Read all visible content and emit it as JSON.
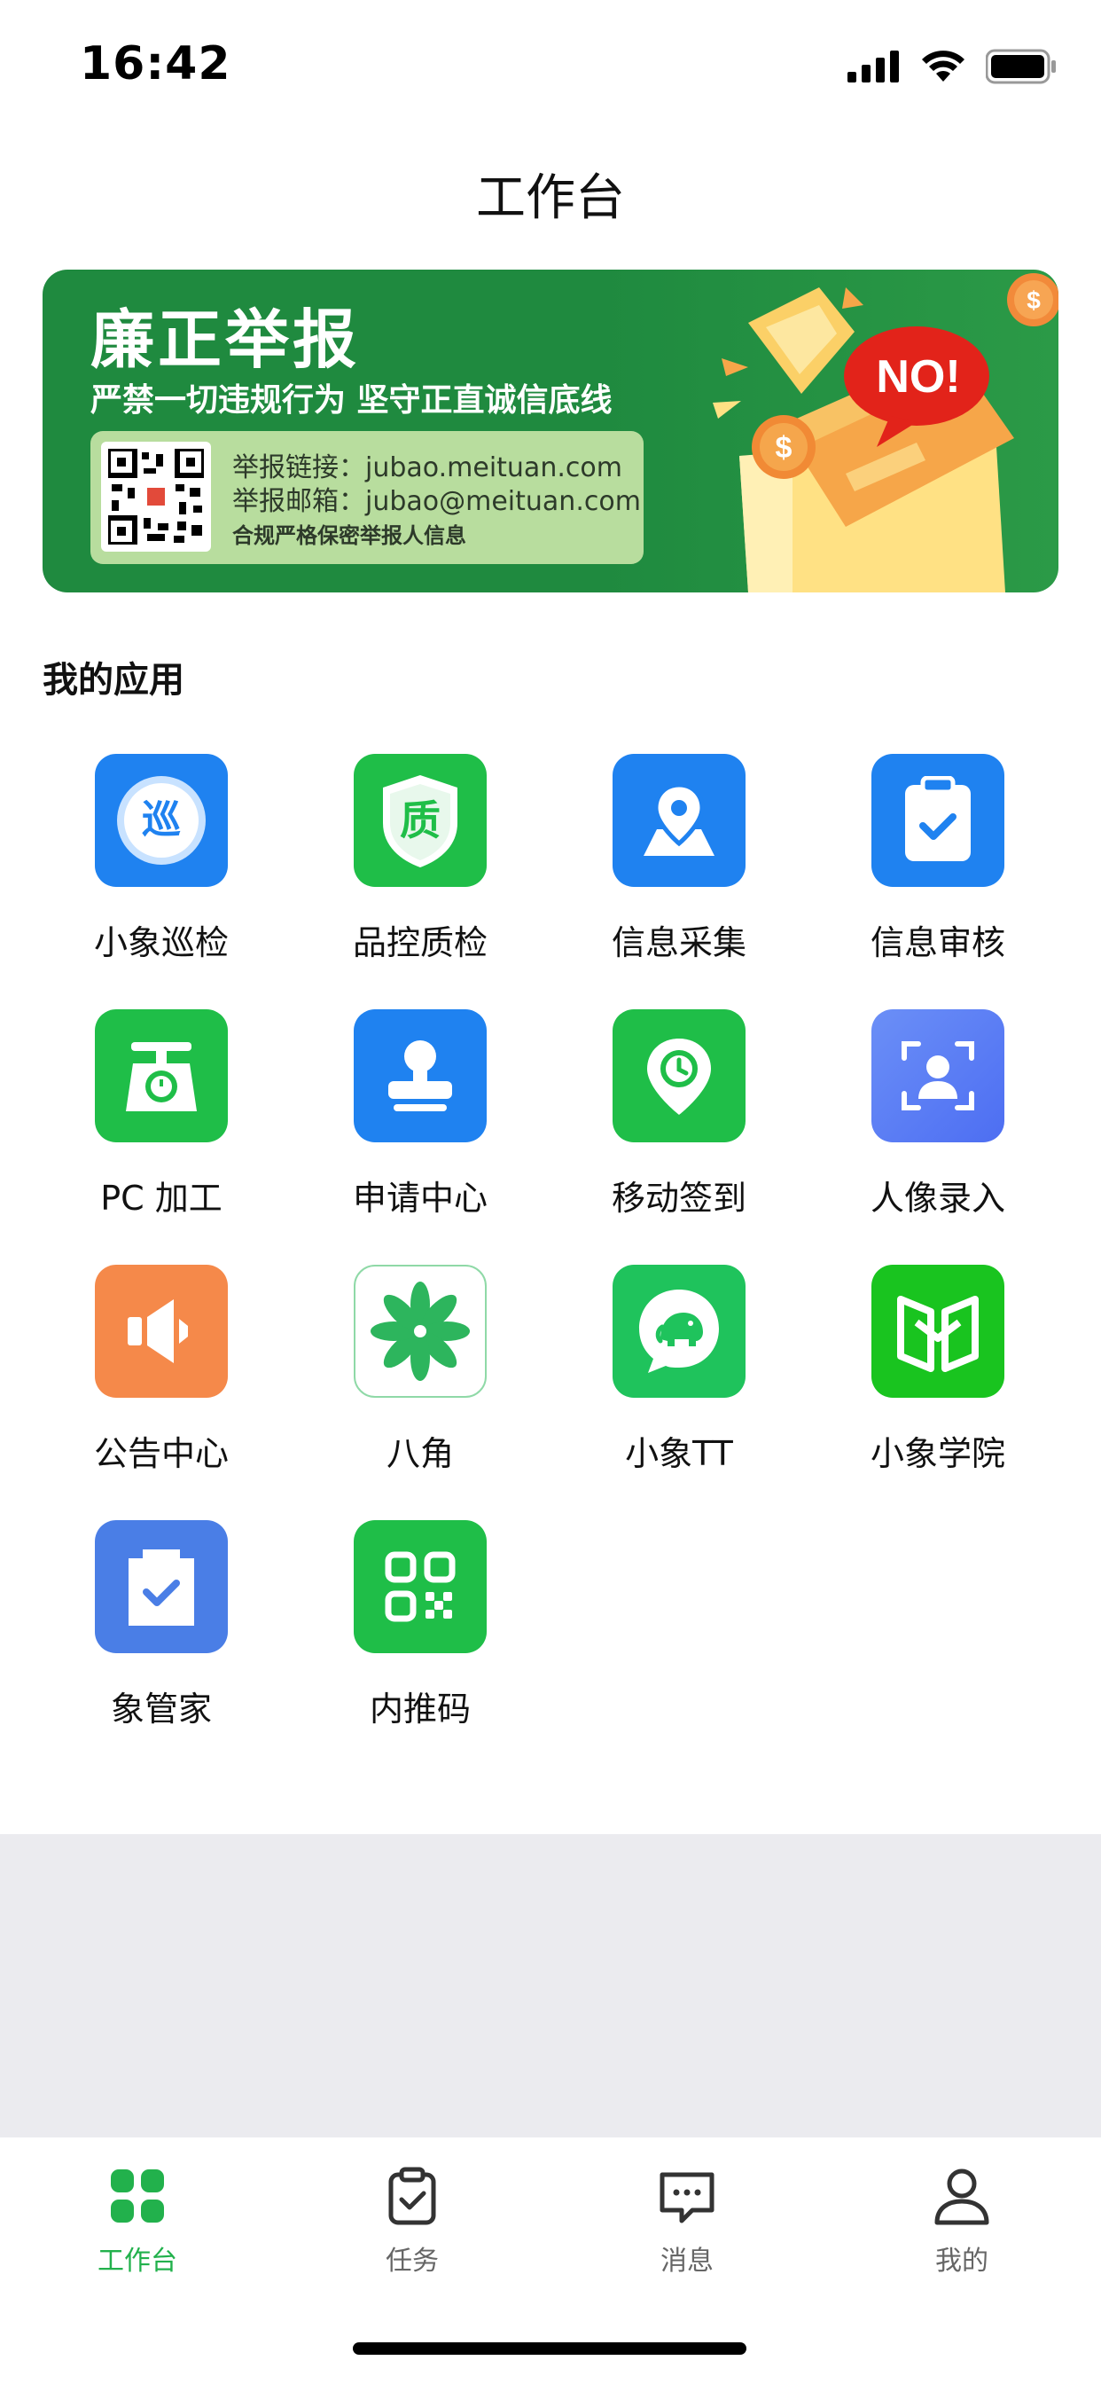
{
  "status_bar": {
    "time": "16:42"
  },
  "header": {
    "title": "工作台"
  },
  "banner": {
    "title": "廉正举报",
    "slogan": "严禁一切违规行为 坚守正直诚信底线",
    "link_line": "举报链接：jubao.meituan.com",
    "email_line": "举报邮箱：jubao@meituan.com",
    "privacy_line": "合规严格保密举报人信息",
    "no_text": "NO!",
    "qr_caption": "廉正举报"
  },
  "apps_section": {
    "title": "我的应用",
    "apps": [
      {
        "label": "小象巡检",
        "icon": "xun-icon",
        "glyph": "巡",
        "color": "#1f82f0"
      },
      {
        "label": "品控质检",
        "icon": "quality-shield-icon",
        "glyph": "质",
        "color": "#1fbe48"
      },
      {
        "label": "信息采集",
        "icon": "map-pin-icon",
        "color": "#1f82f0"
      },
      {
        "label": "信息审核",
        "icon": "clipboard-check-icon",
        "color": "#1f82f0"
      },
      {
        "label": "PC 加工",
        "icon": "scale-icon",
        "color": "#1fbe48"
      },
      {
        "label": "申请中心",
        "icon": "stamp-icon",
        "color": "#1f82f0"
      },
      {
        "label": "移动签到",
        "icon": "clock-pin-icon",
        "color": "#1fbe48"
      },
      {
        "label": "人像录入",
        "icon": "face-scan-icon",
        "color": "#5b7bf5"
      },
      {
        "label": "公告中心",
        "icon": "speaker-icon",
        "color": "#f5894a"
      },
      {
        "label": "八角",
        "icon": "star-anise-icon",
        "color": "#ffffff"
      },
      {
        "label": "小象TT",
        "icon": "elephant-chat-icon",
        "color": "#1fc35c"
      },
      {
        "label": "小象学院",
        "icon": "book-icon",
        "color": "#19c41f"
      },
      {
        "label": "象管家",
        "icon": "butler-clipboard-icon",
        "color": "#4a7ee6"
      },
      {
        "label": "内推码",
        "icon": "qr-code-icon",
        "color": "#1fbe48"
      }
    ]
  },
  "tab_bar": {
    "tabs": [
      {
        "label": "工作台",
        "icon": "grid-icon",
        "active": true
      },
      {
        "label": "任务",
        "icon": "task-clipboard-icon",
        "active": false
      },
      {
        "label": "消息",
        "icon": "message-icon",
        "active": false
      },
      {
        "label": "我的",
        "icon": "profile-icon",
        "active": false
      }
    ]
  },
  "colors": {
    "accent_green": "#22b14c",
    "banner_green": "#1f8a3f",
    "blue": "#1f82f0"
  }
}
